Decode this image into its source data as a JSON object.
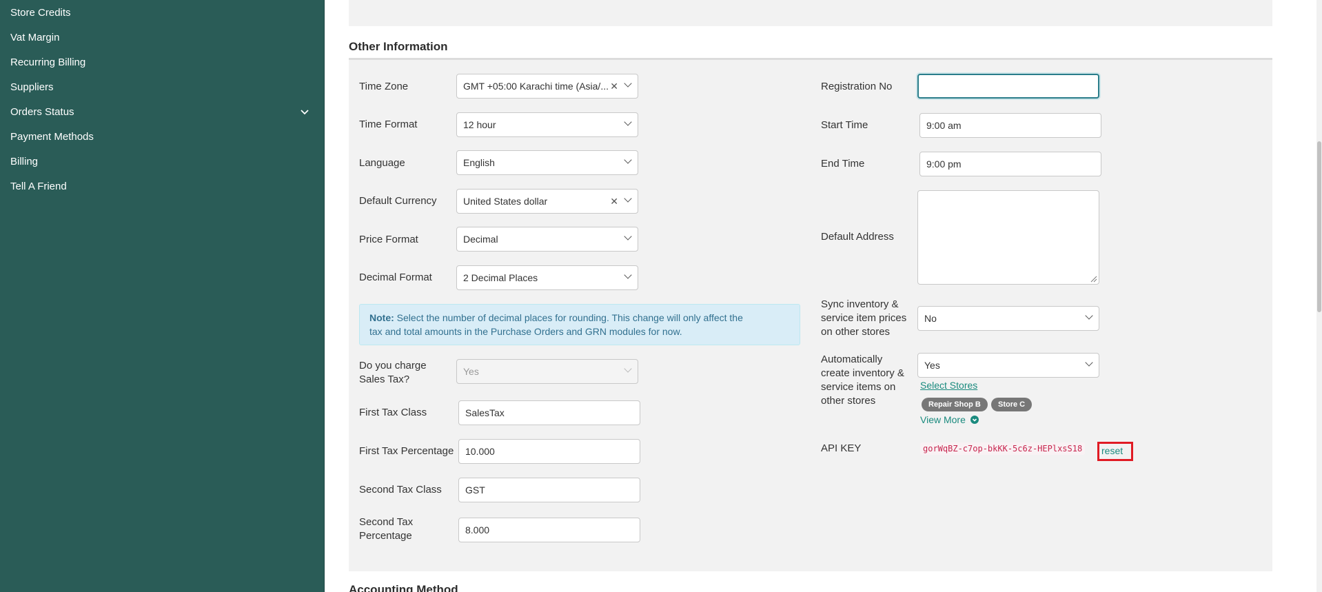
{
  "sidebar": {
    "items": [
      {
        "label": "Store Credits"
      },
      {
        "label": "Vat Margin"
      },
      {
        "label": "Recurring Billing"
      },
      {
        "label": "Suppliers"
      },
      {
        "label": "Orders Status"
      },
      {
        "label": "Payment Methods"
      },
      {
        "label": "Billing"
      },
      {
        "label": "Tell A Friend"
      }
    ]
  },
  "section": {
    "title": "Other Information",
    "next_title": "Accounting Method"
  },
  "left": {
    "time_zone": {
      "label": "Time Zone",
      "value": "GMT +05:00 Karachi time (Asia/..."
    },
    "time_format": {
      "label": "Time Format",
      "value": "12 hour"
    },
    "language": {
      "label": "Language",
      "value": "English"
    },
    "default_currency": {
      "label": "Default Currency",
      "value": "United States dollar"
    },
    "price_format": {
      "label": "Price Format",
      "value": "Decimal"
    },
    "decimal_format": {
      "label": "Decimal Format",
      "value": "2 Decimal Places"
    },
    "note": {
      "prefix": "Note:",
      "line1": "Select the number of decimal places for rounding. This change will only affect the",
      "line2": "tax and total amounts in the Purchase Orders and GRN modules for now."
    },
    "sales_tax": {
      "label_line1": "Do you charge",
      "label_line2": "Sales Tax?",
      "value": "Yes"
    },
    "first_tax_class": {
      "label": "First Tax Class",
      "value": "SalesTax"
    },
    "first_tax_percentage": {
      "label": "First Tax Percentage",
      "value": "10.000"
    },
    "second_tax_class": {
      "label": "Second Tax Class",
      "value": "GST"
    },
    "second_tax_percentage": {
      "label_line1": "Second Tax",
      "label_line2": "Percentage",
      "value": "8.000"
    }
  },
  "right": {
    "registration_no": {
      "label": "Registration No",
      "value": ""
    },
    "start_time": {
      "label": "Start Time",
      "value": "9:00 am"
    },
    "end_time": {
      "label": "End Time",
      "value": "9:00 pm"
    },
    "default_address": {
      "label": "Default Address",
      "value": ""
    },
    "sync_inventory": {
      "label_line1": "Sync inventory &",
      "label_line2": "service item prices",
      "label_line3": "on other stores",
      "value": "No"
    },
    "auto_create": {
      "label_line1": "Automatically",
      "label_line2": "create inventory &",
      "label_line3": "service items on",
      "label_line4": "other stores",
      "value": "Yes",
      "select_stores_link": "Select Stores",
      "stores": [
        "Repair Shop B",
        "Store C"
      ],
      "view_more": "View More"
    },
    "api_key": {
      "label": "API KEY",
      "value": "gorWqBZ-c7op-bkKK-5c6z-HEPlxsS18",
      "reset_label": "reset"
    }
  },
  "colors": {
    "sidebar_bg": "#2a5c57",
    "panel_bg": "#f2f2f2",
    "link": "#1a8a7e",
    "note_bg": "#d9edf7",
    "highlight": "#e01b24"
  }
}
